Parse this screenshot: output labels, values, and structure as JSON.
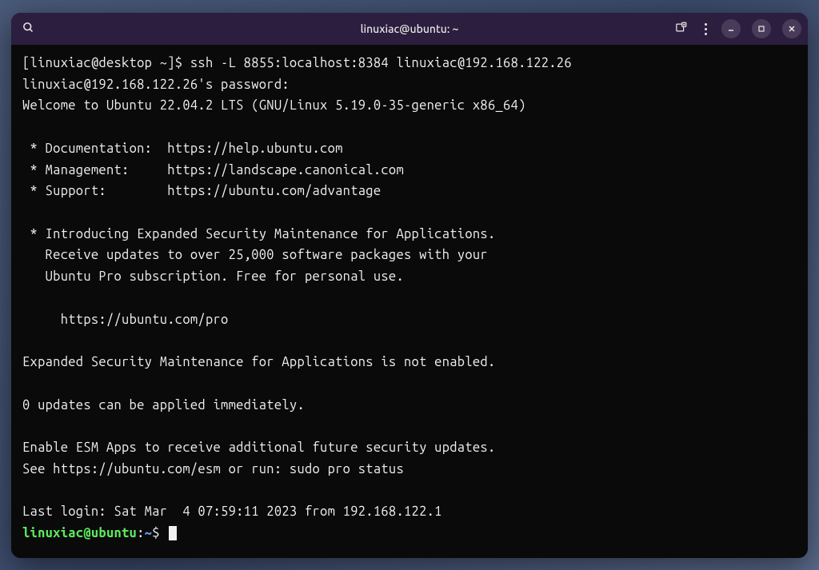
{
  "titlebar": {
    "title": "linuxiac@ubuntu: ~"
  },
  "terminal": {
    "line1_prompt": "[linuxiac@desktop ~]$ ",
    "line1_cmd": "ssh -L 8855:localhost:8384 linuxiac@192.168.122.26",
    "line2": "linuxiac@192.168.122.26's password:",
    "line3": "Welcome to Ubuntu 22.04.2 LTS (GNU/Linux 5.19.0-35-generic x86_64)",
    "blank1": "",
    "line4": " * Documentation:  https://help.ubuntu.com",
    "line5": " * Management:     https://landscape.canonical.com",
    "line6": " * Support:        https://ubuntu.com/advantage",
    "blank2": "",
    "line7": " * Introducing Expanded Security Maintenance for Applications.",
    "line8": "   Receive updates to over 25,000 software packages with your",
    "line9": "   Ubuntu Pro subscription. Free for personal use.",
    "blank3": "",
    "line10": "     https://ubuntu.com/pro",
    "blank4": "",
    "line11": "Expanded Security Maintenance for Applications is not enabled.",
    "blank5": "",
    "line12": "0 updates can be applied immediately.",
    "blank6": "",
    "line13": "Enable ESM Apps to receive additional future security updates.",
    "line14": "See https://ubuntu.com/esm or run: sudo pro status",
    "blank7": "",
    "line15": "Last login: Sat Mar  4 07:59:11 2023 from 192.168.122.1",
    "prompt_user": "linuxiac@ubuntu",
    "prompt_colon": ":",
    "prompt_path": "~",
    "prompt_dollar": "$ "
  }
}
